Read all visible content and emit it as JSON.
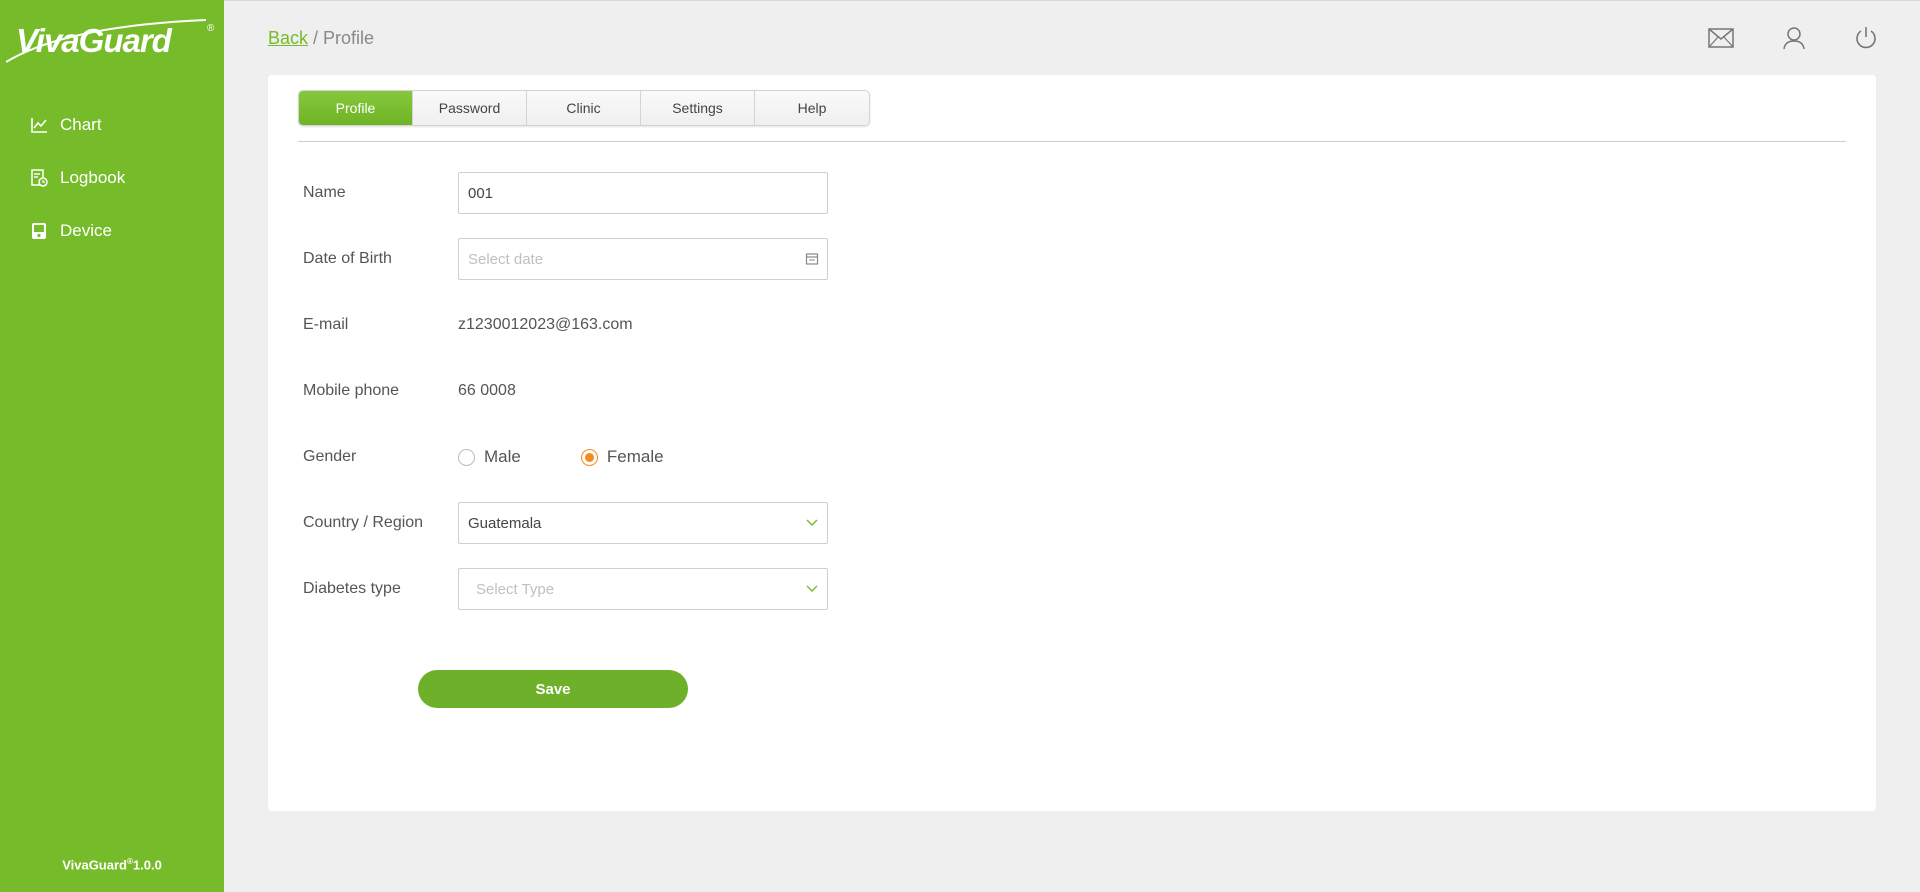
{
  "brand": {
    "logo_text": "VivaGuard",
    "logo_reg": "®",
    "version_name": "VivaGuard",
    "version_reg": "®",
    "version_number": "1.0.0",
    "color": "#76bc2a"
  },
  "sidebar": {
    "items": [
      {
        "label": "Chart",
        "icon": "chart-icon"
      },
      {
        "label": "Logbook",
        "icon": "logbook-icon"
      },
      {
        "label": "Device",
        "icon": "device-icon"
      }
    ]
  },
  "header": {
    "back_label": "Back",
    "separator": " / ",
    "current": "Profile",
    "icons": [
      "mail-icon",
      "user-icon",
      "power-icon"
    ]
  },
  "tabs": [
    {
      "label": "Profile",
      "active": true
    },
    {
      "label": "Password",
      "active": false
    },
    {
      "label": "Clinic",
      "active": false
    },
    {
      "label": "Settings",
      "active": false
    },
    {
      "label": "Help",
      "active": false
    }
  ],
  "form": {
    "name": {
      "label": "Name",
      "value": "001"
    },
    "dob": {
      "label": "Date of Birth",
      "placeholder": "Select date"
    },
    "email": {
      "label": "E-mail",
      "value": "z1230012023@163.com"
    },
    "mobile": {
      "label": "Mobile phone",
      "value": "66 0008"
    },
    "gender": {
      "label": "Gender",
      "options": [
        "Male",
        "Female"
      ],
      "selected": "Female"
    },
    "country": {
      "label": "Country / Region",
      "value": "Guatemala"
    },
    "diabetes": {
      "label": "Diabetes type",
      "placeholder": "Select Type"
    },
    "save_label": "Save"
  },
  "colors": {
    "accent": "#76bc2a",
    "radio_selected": "#f58a1f"
  }
}
